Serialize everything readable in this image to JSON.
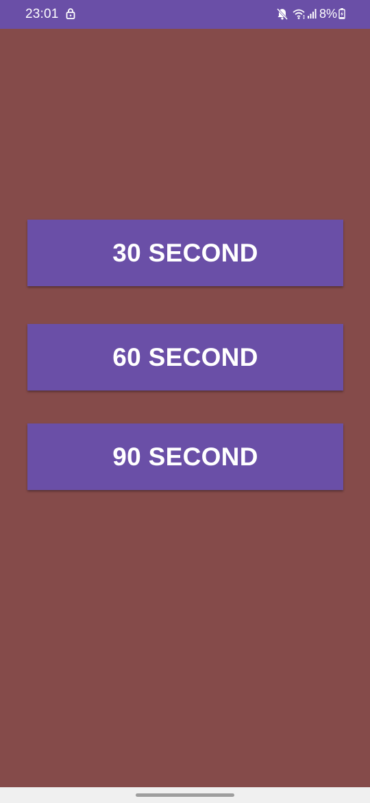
{
  "status_bar": {
    "time": "23:01",
    "battery_percent": "8%",
    "icons": [
      "lock-icon",
      "mute-icon",
      "wifi-icon",
      "signal-icon",
      "battery-charging-icon"
    ]
  },
  "buttons": [
    {
      "label": "30 SECOND"
    },
    {
      "label": "60 SECOND"
    },
    {
      "label": "90 SECOND"
    }
  ],
  "colors": {
    "background": "#854b4a",
    "accent": "#6a4fa7",
    "text": "#ffffff",
    "nav_bar": "#f0f0f0"
  }
}
